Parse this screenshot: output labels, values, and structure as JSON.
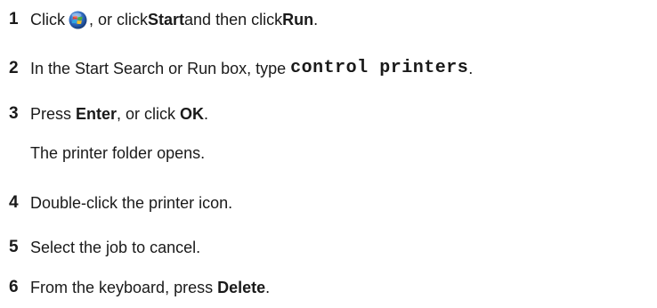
{
  "steps": [
    {
      "number": "1",
      "parts": {
        "a": "Click",
        "icon": "windows-start-orb-icon",
        "b": ", or click ",
        "c": "Start",
        "d": " and then click ",
        "e": "Run",
        "f": "."
      }
    },
    {
      "number": "2",
      "parts": {
        "a": "In the Start Search or Run box, type ",
        "code": "control printers",
        "b": "."
      }
    },
    {
      "number": "3",
      "parts": {
        "a": "Press ",
        "b": "Enter",
        "c": ", or click ",
        "d": "OK",
        "e": "."
      },
      "note": "The printer folder opens."
    },
    {
      "number": "4",
      "parts": {
        "a": "Double-click the printer icon."
      }
    },
    {
      "number": "5",
      "parts": {
        "a": "Select the job to cancel."
      }
    },
    {
      "number": "6",
      "parts": {
        "a": "From the keyboard, press ",
        "b": "Delete",
        "c": "."
      }
    }
  ],
  "colors": {
    "text": "#1a1a1a",
    "icon_blue": "#2a63b8",
    "icon_red": "#e2432a",
    "icon_green": "#4caf3a",
    "icon_yellow": "#f6c324",
    "icon_cyan": "#2fa7e0"
  }
}
